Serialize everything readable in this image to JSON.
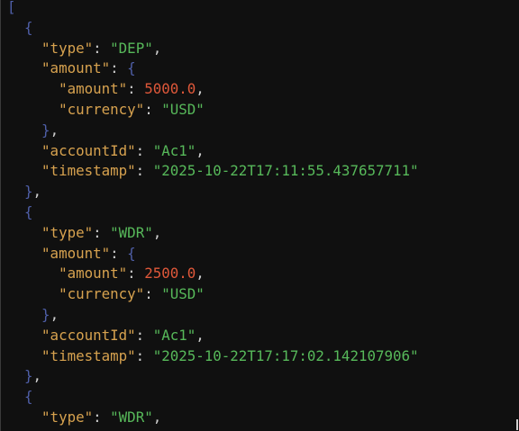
{
  "viewer": {
    "open_array": "[",
    "records": [
      {
        "open": "{",
        "type_key": "\"type\"",
        "type_value": "\"DEP\"",
        "amount_key": "\"amount\"",
        "amount_open": "{",
        "inner_amount_key": "\"amount\"",
        "inner_amount_value": "5000.0",
        "currency_key": "\"currency\"",
        "currency_value": "\"USD\"",
        "amount_close": "}",
        "account_key": "\"accountId\"",
        "account_value": "\"Ac1\"",
        "timestamp_key": "\"timestamp\"",
        "timestamp_value": "\"2025-10-22T17:11:55.437657711\"",
        "close": "}"
      },
      {
        "open": "{",
        "type_key": "\"type\"",
        "type_value": "\"WDR\"",
        "amount_key": "\"amount\"",
        "amount_open": "{",
        "inner_amount_key": "\"amount\"",
        "inner_amount_value": "2500.0",
        "currency_key": "\"currency\"",
        "currency_value": "\"USD\"",
        "amount_close": "}",
        "account_key": "\"accountId\"",
        "account_value": "\"Ac1\"",
        "timestamp_key": "\"timestamp\"",
        "timestamp_value": "\"2025-10-22T17:17:02.142107906\"",
        "close": "}"
      },
      {
        "open": "{",
        "type_key": "\"type\"",
        "type_value": "\"WDR\""
      }
    ],
    "colors": {
      "background": "#101010",
      "bracket": "#4f5fa8",
      "key": "#d7a24f",
      "string": "#57b95a",
      "number": "#e0583a",
      "punctuation": "#cfcfcf"
    }
  }
}
